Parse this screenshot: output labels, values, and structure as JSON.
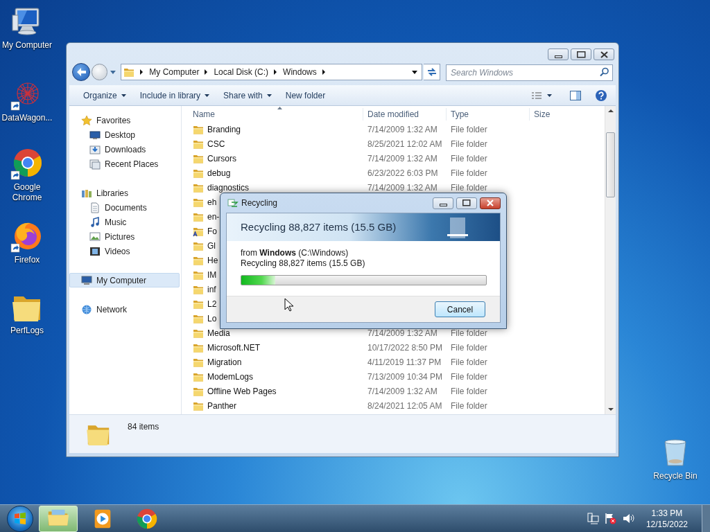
{
  "desktop_icons": [
    {
      "label": "My Computer",
      "kind": "computer",
      "shortcut": false
    },
    {
      "label": "DataWagon...",
      "kind": "datawagon",
      "shortcut": true
    },
    {
      "label": "Google Chrome",
      "kind": "chrome",
      "shortcut": true
    },
    {
      "label": "Firefox",
      "kind": "firefox",
      "shortcut": true
    },
    {
      "label": "PerfLogs",
      "kind": "folder",
      "shortcut": false
    },
    {
      "label": "Recycle Bin",
      "kind": "recycle",
      "shortcut": false
    }
  ],
  "explorer": {
    "address": {
      "crumbs": [
        "My Computer",
        "Local Disk (C:)",
        "Windows"
      ]
    },
    "search": {
      "placeholder": "Search Windows"
    },
    "toolbar": [
      {
        "label": "Organize",
        "dropdown": true
      },
      {
        "label": "Include in library",
        "dropdown": true
      },
      {
        "label": "Share with",
        "dropdown": true
      },
      {
        "label": "New folder",
        "dropdown": false
      }
    ],
    "nav": [
      {
        "label": "Favorites",
        "kind": "favorites",
        "selected": false,
        "children": [
          {
            "label": "Desktop",
            "kind": "desktop",
            "selected": false
          },
          {
            "label": "Downloads",
            "kind": "downloads",
            "selected": false
          },
          {
            "label": "Recent Places",
            "kind": "places",
            "selected": false
          }
        ]
      },
      {
        "label": "Libraries",
        "kind": "libraries",
        "selected": false,
        "children": [
          {
            "label": "Documents",
            "kind": "documents",
            "selected": false
          },
          {
            "label": "Music",
            "kind": "music",
            "selected": false
          },
          {
            "label": "Pictures",
            "kind": "pictures",
            "selected": false
          },
          {
            "label": "Videos",
            "kind": "videos",
            "selected": false
          }
        ]
      },
      {
        "label": "My Computer",
        "kind": "computer",
        "selected": true
      },
      {
        "label": "Network",
        "kind": "network",
        "selected": false
      }
    ],
    "columns": [
      "Name",
      "Date modified",
      "Type",
      "Size"
    ],
    "rows": [
      {
        "name": "Branding",
        "date": "7/14/2009 1:32 AM",
        "type": "File folder",
        "kind": "folder"
      },
      {
        "name": "CSC",
        "date": "8/25/2021 12:02 AM",
        "type": "File folder",
        "kind": "folder"
      },
      {
        "name": "Cursors",
        "date": "7/14/2009 1:32 AM",
        "type": "File folder",
        "kind": "folder"
      },
      {
        "name": "debug",
        "date": "6/23/2022 6:03 PM",
        "type": "File folder",
        "kind": "folder"
      },
      {
        "name": "diagnostics",
        "date": "7/14/2009 1:32 AM",
        "type": "File folder",
        "kind": "folder"
      },
      {
        "name": "eh",
        "kind": "folder"
      },
      {
        "name": "en-",
        "kind": "folder"
      },
      {
        "name": "Fo",
        "kind": "fonts"
      },
      {
        "name": "Gl",
        "kind": "folder"
      },
      {
        "name": "He",
        "kind": "folder"
      },
      {
        "name": "IM",
        "kind": "folder"
      },
      {
        "name": "inf",
        "kind": "folder"
      },
      {
        "name": "L2",
        "kind": "folder"
      },
      {
        "name": "Lo",
        "kind": "folder"
      },
      {
        "name": "Media",
        "date": "7/14/2009 1:32 AM",
        "type": "File folder",
        "kind": "folder"
      },
      {
        "name": "Microsoft.NET",
        "date": "10/17/2022 8:50 PM",
        "type": "File folder",
        "kind": "folder"
      },
      {
        "name": "Migration",
        "date": "4/11/2019 11:37 PM",
        "type": "File folder",
        "kind": "folder"
      },
      {
        "name": "ModemLogs",
        "date": "7/13/2009 10:34 PM",
        "type": "File folder",
        "kind": "folder"
      },
      {
        "name": "Offline Web Pages",
        "date": "7/14/2009 1:32 AM",
        "type": "File folder",
        "kind": "folder"
      },
      {
        "name": "Panther",
        "date": "8/24/2021 12:05 AM",
        "type": "File folder",
        "kind": "folder"
      }
    ],
    "status": {
      "count": "84 items"
    }
  },
  "dialog": {
    "title": "Recycling",
    "heading": "Recycling 88,827 items (15.5 GB)",
    "from": "from **Windows** (C:\\Windows)",
    "detail": "Recycling 88,827 items (15.5 GB)",
    "level": 0.14,
    "button": "Cancel"
  },
  "taskbar": {
    "apps": [
      {
        "kind": "explorer",
        "selected": true
      },
      {
        "kind": "media",
        "selected": false
      },
      {
        "kind": "chrome",
        "selected": false
      }
    ],
    "time": "1:33 PM",
    "date": "12/15/2022"
  }
}
